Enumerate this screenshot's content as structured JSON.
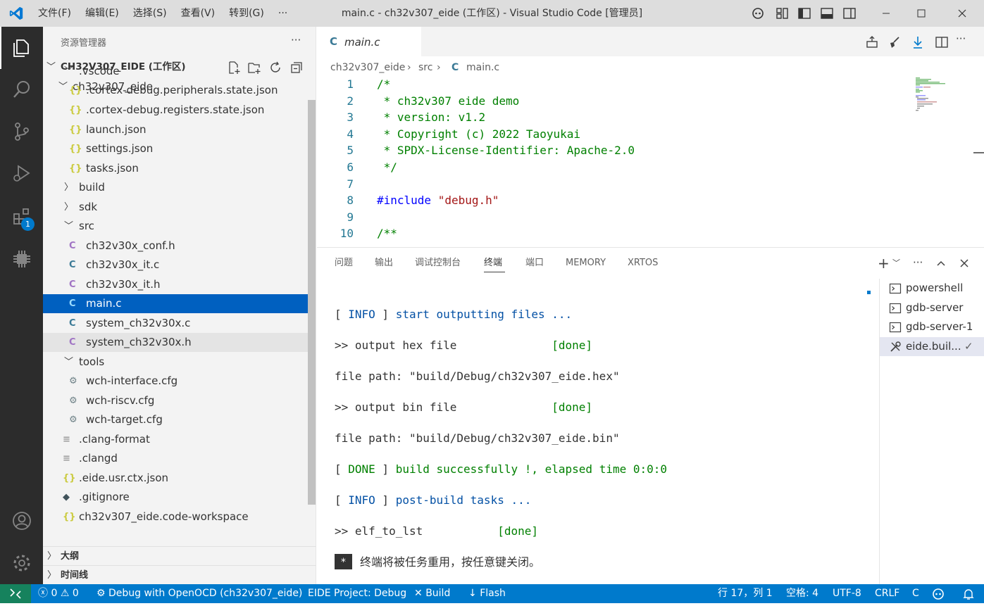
{
  "titlebar": {
    "menus": [
      "文件(F)",
      "编辑(E)",
      "选择(S)",
      "查看(V)",
      "转到(G)",
      "···"
    ],
    "title": "main.c - ch32v307_eide (工作区) - Visual Studio Code [管理员]"
  },
  "activitybar": {
    "extensions_badge": "1"
  },
  "sidebar": {
    "header": "资源管理器",
    "more": "···",
    "workspace": "CH32V307_EIDE (工作区)",
    "folder": "ch32v307_eide",
    "items": [
      {
        "label": ".vscode",
        "type": "folder-open"
      },
      {
        "label": ".cortex-debug.peripherals.state.json",
        "type": "json"
      },
      {
        "label": ".cortex-debug.registers.state.json",
        "type": "json"
      },
      {
        "label": "launch.json",
        "type": "json"
      },
      {
        "label": "settings.json",
        "type": "json"
      },
      {
        "label": "tasks.json",
        "type": "json"
      },
      {
        "label": "build",
        "type": "folder"
      },
      {
        "label": "sdk",
        "type": "folder"
      },
      {
        "label": "src",
        "type": "folder-open"
      },
      {
        "label": "ch32v30x_conf.h",
        "type": "h"
      },
      {
        "label": "ch32v30x_it.c",
        "type": "c"
      },
      {
        "label": "ch32v30x_it.h",
        "type": "h"
      },
      {
        "label": "main.c",
        "type": "c"
      },
      {
        "label": "system_ch32v30x.c",
        "type": "c"
      },
      {
        "label": "system_ch32v30x.h",
        "type": "h"
      },
      {
        "label": "tools",
        "type": "folder-open"
      },
      {
        "label": "wch-interface.cfg",
        "type": "cfg"
      },
      {
        "label": "wch-riscv.cfg",
        "type": "cfg"
      },
      {
        "label": "wch-target.cfg",
        "type": "cfg"
      },
      {
        "label": ".clang-format",
        "type": "text"
      },
      {
        "label": ".clangd",
        "type": "text"
      },
      {
        "label": ".eide.usr.ctx.json",
        "type": "json"
      },
      {
        "label": ".gitignore",
        "type": "git"
      },
      {
        "label": "ch32v307_eide.code-workspace",
        "type": "json"
      }
    ],
    "outline": "大纲",
    "timeline": "时间线"
  },
  "editor": {
    "tab_label": "main.c",
    "tab_icon": "C",
    "breadcrumb": [
      "ch32v307_eide",
      "src",
      "main.c"
    ],
    "lines": [
      {
        "n": "1",
        "text": "/*"
      },
      {
        "n": "2",
        "text": " * ch32v307 eide demo"
      },
      {
        "n": "3",
        "text": " * version: v1.2"
      },
      {
        "n": "4",
        "text": " * Copyright (c) 2022 Taoyukai"
      },
      {
        "n": "5",
        "text": " * SPDX-License-Identifier: Apache-2.0"
      },
      {
        "n": "6",
        "text": " */"
      },
      {
        "n": "7",
        "text": ""
      },
      {
        "n": "8",
        "directive": "#include",
        "string": "\"debug.h\""
      },
      {
        "n": "9",
        "text": ""
      },
      {
        "n": "10",
        "text": "/**"
      }
    ]
  },
  "panel": {
    "tabs": [
      "问题",
      "输出",
      "调试控制台",
      "终端",
      "端口",
      "MEMORY",
      "XRTOS"
    ],
    "active_tab": "终端",
    "terminal_lines": [
      {
        "prefix": "[ ",
        "tag": "INFO",
        "suffix": " ] ",
        "msg": "start outputting files ...",
        "color": "#0451a5"
      },
      {
        "plain": ">> output hex file              ",
        "done": "[done]"
      },
      {
        "plain": "file path: \"build/Debug/ch32v307_eide.hex\""
      },
      {
        "plain": ">> output bin file              ",
        "done": "[done]"
      },
      {
        "plain": "file path: \"build/Debug/ch32v307_eide.bin\""
      },
      {
        "prefix": "[ ",
        "tag": "DONE",
        "suffix": " ] ",
        "msg": "build successfully !, elapsed time 0:0:0",
        "color": "#008000"
      },
      {
        "prefix": "[ ",
        "tag": "INFO",
        "suffix": " ] ",
        "msg": "post-build tasks ...",
        "color": "#0451a5"
      },
      {
        "plain": ">> elf_to_lst           ",
        "done": "[done]"
      }
    ],
    "reuse_marker": "*",
    "reuse_text": "终端将被任务重用，按任意键关闭。",
    "terminals": [
      "powershell",
      "gdb-server",
      "gdb-server-1",
      "eide.buil..."
    ]
  },
  "statusbar": {
    "errors": "0",
    "warnings": "0",
    "debug": "Debug with OpenOCD (ch32v307_eide)",
    "project": "EIDE Project: Debug",
    "build": "Build",
    "flash": "Flash",
    "position": "行 17，列 1",
    "spaces": "空格: 4",
    "encoding": "UTF-8",
    "eol": "CRLF",
    "language": "C"
  },
  "colors": {
    "accent": "#007acc",
    "selected_row": "#0060c0",
    "comment": "#008000",
    "directive": "#0000ff",
    "string": "#a31515"
  }
}
